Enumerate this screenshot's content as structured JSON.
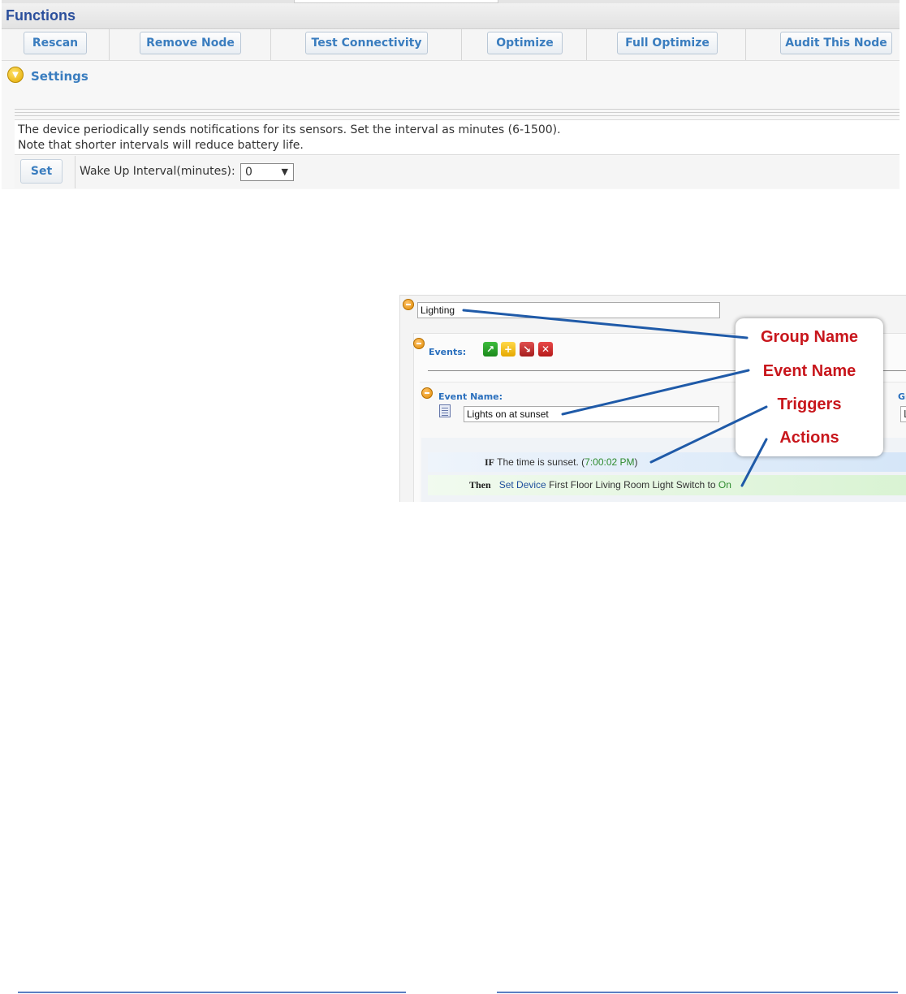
{
  "functions_panel": {
    "title": "Functions",
    "buttons": [
      "Rescan",
      "Remove Node",
      "Test Connectivity",
      "Optimize",
      "Full Optimize",
      "Audit This Node"
    ],
    "settings_label": "Settings",
    "description_line1": "The device periodically sends notifications for its sensors. Set the interval as minutes (6-1500).",
    "description_line2": "Note that shorter intervals will reduce battery life.",
    "set_button": "Set",
    "wake_label": "Wake Up Interval(minutes):",
    "wake_value": "0"
  },
  "event_editor": {
    "group_name_value": "Lighting",
    "events_label": "Events:",
    "event_name_label": "Event Name:",
    "event_name_value": "Lights on at sunset",
    "gr_label": "Gr",
    "gr_value": "L",
    "if_keyword": "IF",
    "if_text": "The time is sunset. (",
    "if_time": "7:00:02 PM",
    "if_close": ")",
    "then_keyword": "Then",
    "then_set_device": "Set Device",
    "then_device": "First Floor Living Room Light Switch",
    "then_to": "to",
    "then_state": "On"
  },
  "callout": {
    "labels": [
      "Group Name",
      "Event Name",
      "Triggers",
      "Actions"
    ]
  },
  "colors": {
    "accent_blue": "#3a7dbf",
    "callout_red": "#c8161c",
    "leader_blue": "#1f5aa8"
  }
}
